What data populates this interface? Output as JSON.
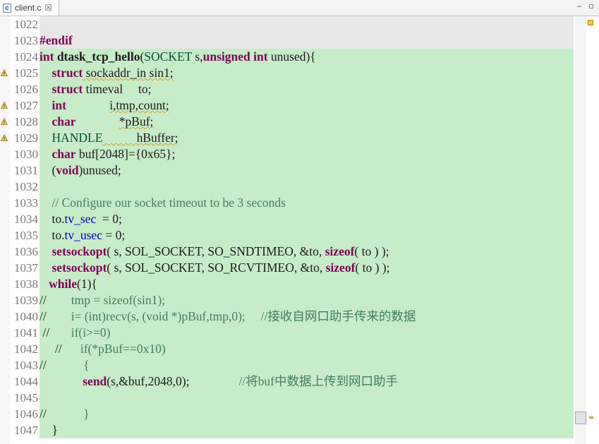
{
  "tab": {
    "icon": "c",
    "label": "client.c",
    "close": "☒"
  },
  "window_controls": {
    "minimize": "‒",
    "maximize": "▫"
  },
  "lines": [
    {
      "num": "1022",
      "hl": "grey",
      "warn": false,
      "segs": []
    },
    {
      "num": "1023",
      "hl": "grey",
      "warn": false,
      "segs": [
        {
          "t": "#endif",
          "c": "kw"
        }
      ]
    },
    {
      "num": "1024",
      "hl": "green",
      "warn": false,
      "segs": [
        {
          "t": "int ",
          "c": "kw"
        },
        {
          "t": "dtask_tcp_hello",
          "c": "fn"
        },
        {
          "t": "("
        },
        {
          "t": "SOCKET",
          "c": "ty"
        },
        {
          "t": " s,"
        },
        {
          "t": "unsigned int",
          "c": "kw"
        },
        {
          "t": " unused){"
        }
      ]
    },
    {
      "num": "1025",
      "hl": "green",
      "warn": true,
      "segs": [
        {
          "t": "    "
        },
        {
          "t": "struct",
          "c": "kw"
        },
        {
          "t": " sockaddr_in sin1;",
          "c": "warn"
        }
      ]
    },
    {
      "num": "1026",
      "hl": "green",
      "warn": false,
      "segs": [
        {
          "t": "    "
        },
        {
          "t": "struct",
          "c": "kw"
        },
        {
          "t": " timeval     to;"
        }
      ]
    },
    {
      "num": "1027",
      "hl": "green",
      "warn": true,
      "segs": [
        {
          "t": "    "
        },
        {
          "t": "int",
          "c": "kw"
        },
        {
          "t": "              "
        },
        {
          "t": "i,tmp,count;",
          "c": "warn"
        }
      ]
    },
    {
      "num": "1028",
      "hl": "green",
      "warn": true,
      "segs": [
        {
          "t": "    "
        },
        {
          "t": "char",
          "c": "kw"
        },
        {
          "t": "              "
        },
        {
          "t": "*pBuf;",
          "c": "warn"
        }
      ]
    },
    {
      "num": "1029",
      "hl": "green",
      "warn": true,
      "segs": [
        {
          "t": "    "
        },
        {
          "t": "HANDLE",
          "c": "ty"
        },
        {
          "t": "           hBuffer;",
          "c": "warn"
        }
      ]
    },
    {
      "num": "1030",
      "hl": "green",
      "warn": false,
      "segs": [
        {
          "t": "    "
        },
        {
          "t": "char",
          "c": "kw"
        },
        {
          "t": " buf[2048]={0x65};"
        }
      ]
    },
    {
      "num": "1031",
      "hl": "green",
      "warn": false,
      "segs": [
        {
          "t": "    ("
        },
        {
          "t": "void",
          "c": "kw"
        },
        {
          "t": ")unused;"
        }
      ]
    },
    {
      "num": "1032",
      "hl": "green",
      "warn": false,
      "segs": []
    },
    {
      "num": "1033",
      "hl": "green",
      "warn": false,
      "segs": [
        {
          "t": "    "
        },
        {
          "t": "// Configure our socket timeout to be 3 seconds",
          "c": "cm"
        }
      ]
    },
    {
      "num": "1034",
      "hl": "green",
      "warn": false,
      "segs": [
        {
          "t": "    to."
        },
        {
          "t": "tv_sec",
          "c": "fld"
        },
        {
          "t": "  = 0;"
        }
      ]
    },
    {
      "num": "1035",
      "hl": "green",
      "warn": false,
      "segs": [
        {
          "t": "    to."
        },
        {
          "t": "tv_usec",
          "c": "fld"
        },
        {
          "t": " = 0;"
        }
      ]
    },
    {
      "num": "1036",
      "hl": "green",
      "warn": false,
      "segs": [
        {
          "t": "    "
        },
        {
          "t": "setsockopt",
          "c": "kw"
        },
        {
          "t": "( s, SOL_SOCKET, SO_SNDTIMEO, &to, "
        },
        {
          "t": "sizeof",
          "c": "kw"
        },
        {
          "t": "( to ) );"
        }
      ]
    },
    {
      "num": "1037",
      "hl": "green",
      "warn": false,
      "segs": [
        {
          "t": "    "
        },
        {
          "t": "setsockopt",
          "c": "kw"
        },
        {
          "t": "( s, SOL_SOCKET, SO_RCVTIMEO, &to, "
        },
        {
          "t": "sizeof",
          "c": "kw"
        },
        {
          "t": "( to ) );"
        }
      ]
    },
    {
      "num": "1038",
      "hl": "green",
      "warn": false,
      "segs": [
        {
          "t": "   "
        },
        {
          "t": "while",
          "c": "kw"
        },
        {
          "t": "(1){"
        }
      ]
    },
    {
      "num": "1039",
      "hl": "green",
      "warn": false,
      "segs": [
        {
          "t": "//        "
        },
        {
          "t": "tmp = sizeof(sin1);",
          "c": "cm"
        }
      ]
    },
    {
      "num": "1040",
      "hl": "green",
      "warn": false,
      "segs": [
        {
          "t": "//        "
        },
        {
          "t": "i= (int)recv(s, (void *)pBuf,tmp,0);     //接收自网口助手传来的数据",
          "c": "cm"
        }
      ]
    },
    {
      "num": "1041",
      "hl": "green",
      "warn": false,
      "segs": [
        {
          "t": " //       "
        },
        {
          "t": "if(i>=0)",
          "c": "cm"
        }
      ]
    },
    {
      "num": "1042",
      "hl": "green",
      "warn": false,
      "segs": [
        {
          "t": "     //      "
        },
        {
          "t": "if(*pBuf==0x10)",
          "c": "cm"
        }
      ]
    },
    {
      "num": "1043",
      "hl": "green",
      "warn": false,
      "segs": [
        {
          "t": "//            "
        },
        {
          "t": "{",
          "c": "cm"
        }
      ]
    },
    {
      "num": "1044",
      "hl": "green",
      "warn": false,
      "segs": [
        {
          "t": "              "
        },
        {
          "t": "send",
          "c": "kw"
        },
        {
          "t": "(s,&buf,2048,0);                "
        },
        {
          "t": "//将buf中数据上传到网口助手",
          "c": "cm"
        }
      ]
    },
    {
      "num": "1045",
      "hl": "green",
      "warn": false,
      "segs": []
    },
    {
      "num": "1046",
      "hl": "green",
      "warn": false,
      "segs": [
        {
          "t": "//            "
        },
        {
          "t": "}",
          "c": "cm"
        }
      ]
    },
    {
      "num": "1047",
      "hl": "green",
      "warn": false,
      "segs": [
        {
          "t": "    }"
        }
      ]
    }
  ]
}
